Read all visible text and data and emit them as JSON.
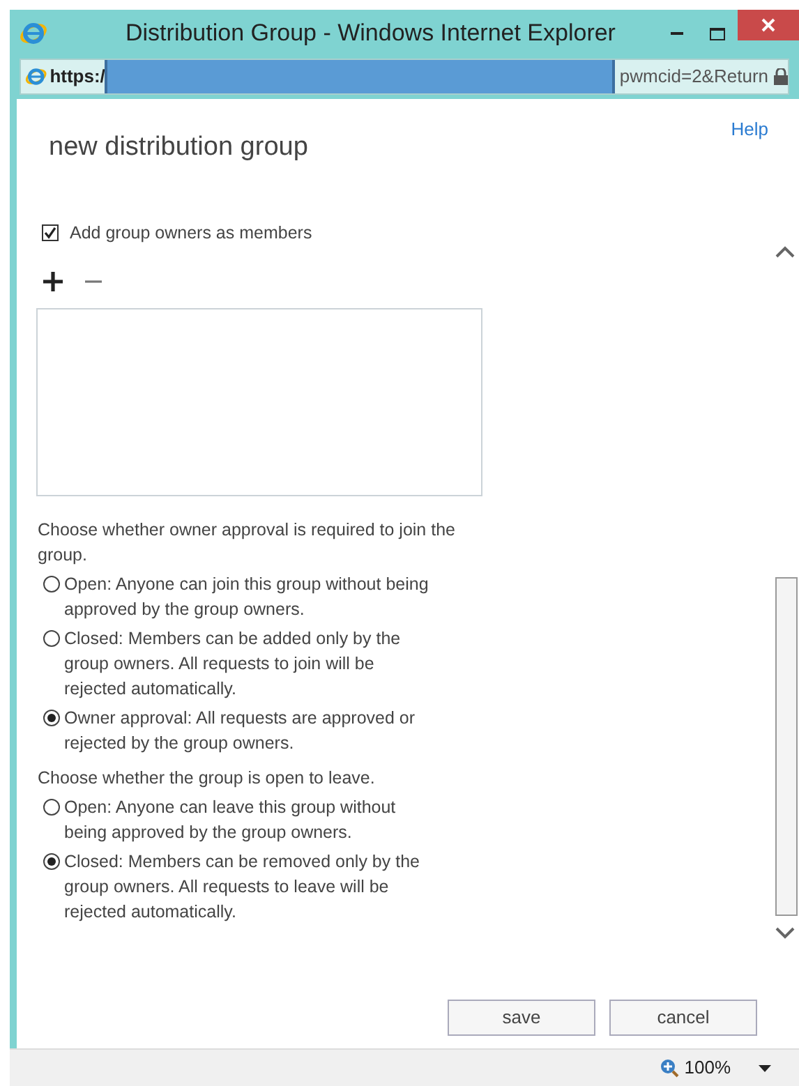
{
  "window": {
    "title": "Distribution Group - Windows Internet Explorer"
  },
  "address_bar": {
    "prefix": "https:/",
    "suffix": "pwmcid=2&Return"
  },
  "help_link": "Help",
  "page_title": "new distribution group",
  "add_owners": {
    "label": "Add group owners as members",
    "checked": true
  },
  "settings": [
    {
      "prompt": "Choose whether owner approval is required to join the group.",
      "options": [
        {
          "label": "Open: Anyone can join this group without being approved by the group owners.",
          "selected": false
        },
        {
          "label": "Closed: Members can be added only by the group owners. All requests to join will be rejected automatically.",
          "selected": false
        },
        {
          "label": "Owner approval: All requests are approved or rejected by the group owners.",
          "selected": true
        }
      ]
    },
    {
      "prompt": "Choose whether the group is open to leave.",
      "options": [
        {
          "label": "Open: Anyone can leave this group without being approved by the group owners.",
          "selected": false
        },
        {
          "label": "Closed: Members can be removed only by the group owners. All requests to leave will be rejected automatically.",
          "selected": true
        }
      ]
    }
  ],
  "buttons": [
    "save",
    "cancel"
  ],
  "status_bar": {
    "zoom": "100%"
  }
}
